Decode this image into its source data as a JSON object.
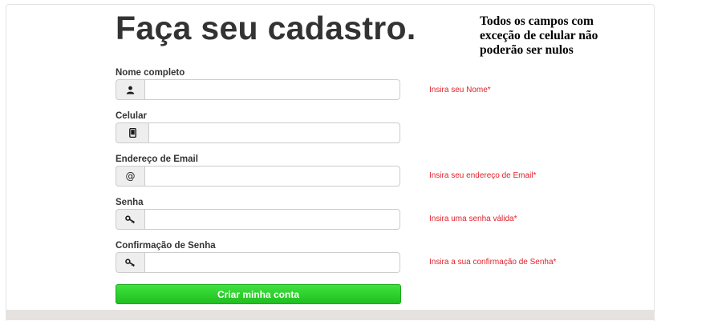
{
  "header": {
    "title": "Faça seu cadastro.",
    "note_lines": [
      "Todos os campos com",
      "exceção de celular não",
      "poderão ser nulos"
    ]
  },
  "form": {
    "fields": [
      {
        "label": "Nome completo",
        "value": "",
        "icon": "user-icon",
        "error": "Insira seu Nome*"
      },
      {
        "label": "Celular",
        "value": "",
        "icon": "phone-icon",
        "error": ""
      },
      {
        "label": "Endereço de Email",
        "value": "",
        "icon": "at-icon",
        "addon_text": "@",
        "error": "Insira seu endereço de Email*"
      },
      {
        "label": "Senha",
        "value": "",
        "icon": "key-icon",
        "error": "Insira uma senha válida*"
      },
      {
        "label": "Confirmação de Senha",
        "value": "",
        "icon": "key-icon",
        "error": "Insira a sua confirmação de Senha*"
      }
    ],
    "submit_label": "Criar minha conta"
  },
  "colors": {
    "error": "#e0202a",
    "submit": "#2bd02b",
    "title": "#333333"
  }
}
